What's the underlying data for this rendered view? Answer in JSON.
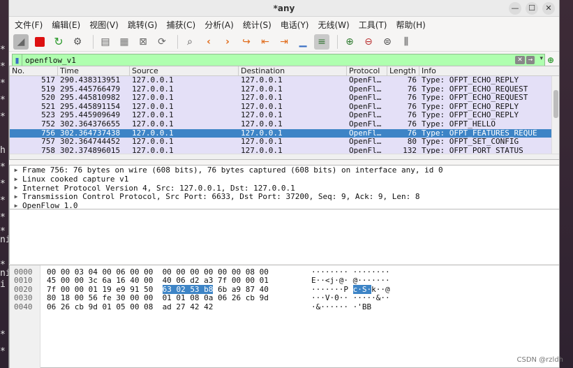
{
  "window": {
    "title": "*any"
  },
  "terminal_glyphs": [
    "*",
    "*",
    "*",
    "*",
    "*",
    "h",
    "*",
    "*",
    "*",
    "*",
    "*",
    "ni",
    "*",
    "ni",
    "i",
    "*",
    "*"
  ],
  "menu": [
    "文件(F)",
    "编辑(E)",
    "视图(V)",
    "跳转(G)",
    "捕获(C)",
    "分析(A)",
    "统计(S)",
    "电话(Y)",
    "无线(W)",
    "工具(T)",
    "帮助(H)"
  ],
  "filter": {
    "value": "openflow_v1"
  },
  "columns": {
    "no": "No.",
    "time": "Time",
    "source": "Source",
    "destination": "Destination",
    "protocol": "Protocol",
    "length": "Length",
    "info": "Info"
  },
  "packets": [
    {
      "no": "517",
      "time": "290.438313951",
      "source": "127.0.0.1",
      "destination": "127.0.0.1",
      "protocol": "OpenFl…",
      "length": "76",
      "info": "Type: OFPT_ECHO_REPLY"
    },
    {
      "no": "519",
      "time": "295.445766479",
      "source": "127.0.0.1",
      "destination": "127.0.0.1",
      "protocol": "OpenFl…",
      "length": "76",
      "info": "Type: OFPT_ECHO_REQUEST"
    },
    {
      "no": "520",
      "time": "295.445810982",
      "source": "127.0.0.1",
      "destination": "127.0.0.1",
      "protocol": "OpenFl…",
      "length": "76",
      "info": "Type: OFPT_ECHO_REQUEST"
    },
    {
      "no": "521",
      "time": "295.445891154",
      "source": "127.0.0.1",
      "destination": "127.0.0.1",
      "protocol": "OpenFl…",
      "length": "76",
      "info": "Type: OFPT_ECHO_REPLY"
    },
    {
      "no": "523",
      "time": "295.445909649",
      "source": "127.0.0.1",
      "destination": "127.0.0.1",
      "protocol": "OpenFl…",
      "length": "76",
      "info": "Type: OFPT_ECHO_REPLY"
    },
    {
      "no": "752",
      "time": "302.364376655",
      "source": "127.0.0.1",
      "destination": "127.0.0.1",
      "protocol": "OpenFl…",
      "length": "76",
      "info": "Type: OFPT_HELLO"
    },
    {
      "no": "756",
      "time": "302.364737438",
      "source": "127.0.0.1",
      "destination": "127.0.0.1",
      "protocol": "OpenFl…",
      "length": "76",
      "info": "Type: OFPT_FEATURES_REQUE"
    },
    {
      "no": "757",
      "time": "302.364744452",
      "source": "127.0.0.1",
      "destination": "127.0.0.1",
      "protocol": "OpenFl…",
      "length": "80",
      "info": "Type: OFPT_SET_CONFIG"
    },
    {
      "no": "758",
      "time": "302.374896015",
      "source": "127.0.0.1",
      "destination": "127.0.0.1",
      "protocol": "OpenFl…",
      "length": "132",
      "info": "Type: OFPT_PORT_STATUS"
    }
  ],
  "selected_packet_index": 6,
  "details": [
    "Frame 756: 76 bytes on wire (608 bits), 76 bytes captured (608 bits) on interface any, id 0",
    "Linux cooked capture v1",
    "Internet Protocol Version 4, Src: 127.0.0.1, Dst: 127.0.0.1",
    "Transmission Control Protocol, Src Port: 6633, Dst Port: 37200, Seq: 9, Ack: 9, Len: 8",
    "OpenFlow 1.0"
  ],
  "bytes": [
    {
      "offset": "0000",
      "hex_pre": "00 00 03 04 00 06 00 00  00 00 00 00 00 00 08 00",
      "hex_hl": "",
      "hex_post": "",
      "ascii_pre": "········ ········",
      "ascii_hl": "",
      "ascii_post": ""
    },
    {
      "offset": "0010",
      "hex_pre": "45 00 00 3c 6a 16 40 00  40 06 d2 a3 7f 00 00 01",
      "hex_hl": "",
      "hex_post": "",
      "ascii_pre": "E··<j·@· @·······",
      "ascii_hl": "",
      "ascii_post": ""
    },
    {
      "offset": "0020",
      "hex_pre": "7f 00 00 01 19 e9 91 50  ",
      "hex_hl": "63 02 53 b8",
      "hex_post": " 6b a9 87 40",
      "ascii_pre": "·······P ",
      "ascii_hl": "c·S·",
      "ascii_post": "k··@"
    },
    {
      "offset": "0030",
      "hex_pre": "80 18 00 56 fe 30 00 00  01 01 08 0a 06 26 cb 9d",
      "hex_hl": "",
      "hex_post": "",
      "ascii_pre": "···V·0·· ·····&··",
      "ascii_hl": "",
      "ascii_post": ""
    },
    {
      "offset": "0040",
      "hex_pre": "06 26 cb 9d 01 05 00 08  ad 27 42 42",
      "hex_hl": "",
      "hex_post": "",
      "ascii_pre": "·&······ ·'BB",
      "ascii_hl": "",
      "ascii_post": ""
    }
  ],
  "watermark": "CSDN @rzldh",
  "colors": {
    "filter_bg": "#afffaf",
    "row_bg": "#e4e0f7",
    "selected_bg": "#3d84c6"
  }
}
